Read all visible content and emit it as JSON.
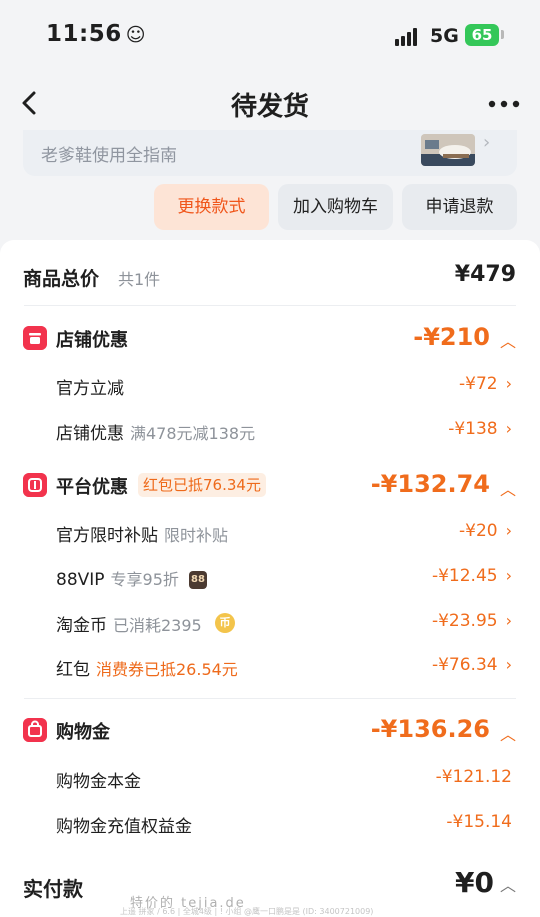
{
  "status": {
    "time": "11:56",
    "face": "☺",
    "network": "5G",
    "battery": "65"
  },
  "nav": {
    "title": "待发货"
  },
  "guide": {
    "text": "老爹鞋使用全指南",
    "arrow": "›"
  },
  "actions": {
    "change_style": "更换款式",
    "add_to_cart": "加入购物车",
    "refund": "申请退款"
  },
  "total": {
    "label": "商品总价",
    "count": "共1件",
    "amount": "¥479"
  },
  "store_discount": {
    "label": "店铺优惠",
    "amount": "-¥210",
    "items": [
      {
        "label": "官方立减",
        "tag": "",
        "amount": "-¥72"
      },
      {
        "label": "店铺优惠",
        "tag": "满478元减138元",
        "amount": "-¥138"
      }
    ]
  },
  "platform_discount": {
    "label": "平台优惠",
    "pill": "红包已抵76.34元",
    "amount": "-¥132.74",
    "items": [
      {
        "label": "官方限时补贴",
        "tag": "限时补贴",
        "amount": "-¥20"
      },
      {
        "label": "88VIP",
        "tag": "专享95折",
        "badge": "88",
        "amount": "-¥12.45"
      },
      {
        "label": "淘金币",
        "tag": "已消耗2395",
        "amount": "-¥23.95"
      },
      {
        "label": "红包",
        "tag": "消费券已抵26.54元",
        "amount": "-¥76.34"
      }
    ]
  },
  "shopping_gold": {
    "label": "购物金",
    "amount": "-¥136.26",
    "items": [
      {
        "label": "购物金本金",
        "amount": "-¥121.12"
      },
      {
        "label": "购物金充值权益金",
        "amount": "-¥15.14"
      }
    ]
  },
  "payment": {
    "label": "实付款",
    "amount": "¥0"
  },
  "watermark": {
    "main": "特价的 tejia.de",
    "small": "上遥 拼家 / 6.6 | 全城4级 | ! 小组 @鹰一口鹏是是 (ID: 3400721009)"
  },
  "colors": {
    "accent": "#f06c1c",
    "store_icon": "#f2334d",
    "primary_button_bg": "#fde4d6"
  }
}
